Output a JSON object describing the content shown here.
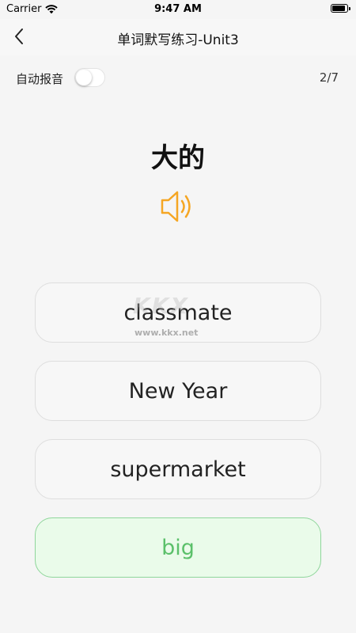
{
  "status_bar": {
    "carrier": "Carrier",
    "time": "9:47 AM",
    "battery_level": 1
  },
  "nav": {
    "title": "单词默写练习-Unit3"
  },
  "toolbar": {
    "auto_play_label": "自动报音",
    "auto_play_on": false,
    "progress": "2/7"
  },
  "question": {
    "word": "大的"
  },
  "options": [
    {
      "label": "classmate"
    },
    {
      "label": "New Year"
    },
    {
      "label": "supermarket"
    },
    {
      "label": "big"
    }
  ],
  "watermark": {
    "logo": "KKX",
    "url": "www.kkx.net"
  },
  "colors": {
    "speaker": "#f5a623",
    "selected_border": "#8fd69b",
    "selected_text": "#5bc06a",
    "selected_bg": "#eafbea"
  }
}
